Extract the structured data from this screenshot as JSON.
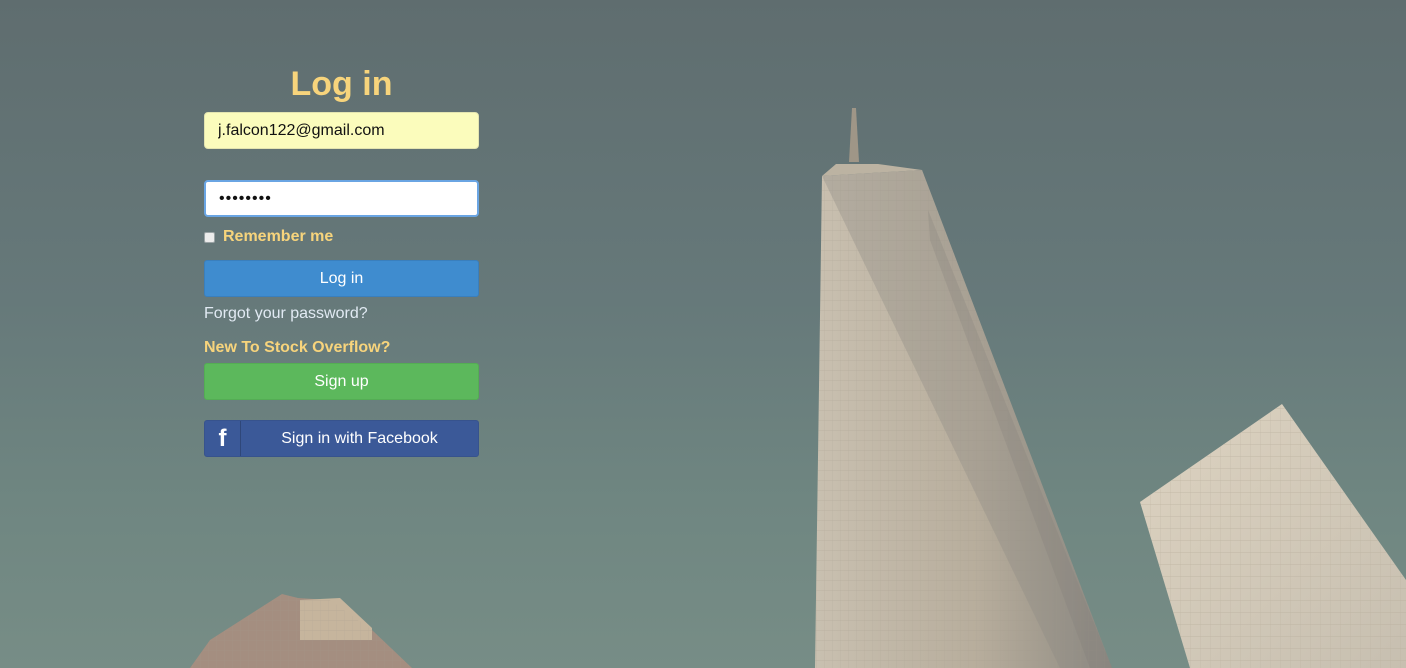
{
  "form": {
    "title": "Log in",
    "email_value": "j.falcon122@gmail.com",
    "password_value": "password",
    "remember_label": "Remember me",
    "login_button": "Log in",
    "forgot_link": "Forgot your password?",
    "new_to_text": "New To Stock Overflow?",
    "signup_button": "Sign up",
    "facebook_button": "Sign in with Facebook",
    "facebook_icon": "f"
  },
  "colors": {
    "title": "#f7d47c",
    "login_button": "#3f8ccf",
    "signup_button": "#5cb85c",
    "facebook_button": "#3b5998",
    "email_field": "#fbfcbc"
  },
  "icons": {
    "facebook": "facebook-icon"
  }
}
